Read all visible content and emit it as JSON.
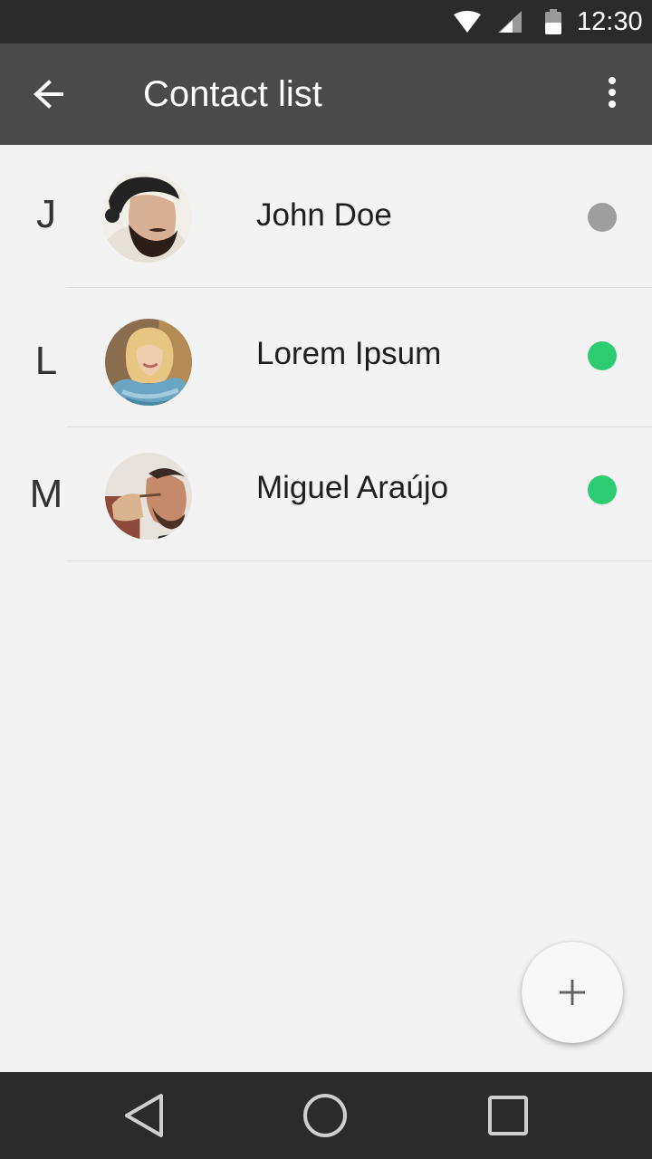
{
  "status_bar": {
    "time": "12:30",
    "icons": [
      "wifi-icon",
      "cell-signal-icon",
      "battery-icon"
    ]
  },
  "app_bar": {
    "title": "Contact list",
    "back_icon": "arrow-left-icon",
    "menu_icon": "more-vert-icon",
    "background": "#4a4a4a"
  },
  "contacts": [
    {
      "letter": "J",
      "name": "John Doe",
      "status": "offline",
      "status_color": "#9e9e9e"
    },
    {
      "letter": "L",
      "name": "Lorem Ipsum",
      "status": "online",
      "status_color": "#2ecc71"
    },
    {
      "letter": "M",
      "name": "Miguel Araújo",
      "status": "online",
      "status_color": "#2ecc71"
    }
  ],
  "fab": {
    "icon": "plus-icon"
  },
  "nav_bar": {
    "icons": [
      "back-triangle-icon",
      "home-circle-icon",
      "recents-square-icon"
    ]
  }
}
